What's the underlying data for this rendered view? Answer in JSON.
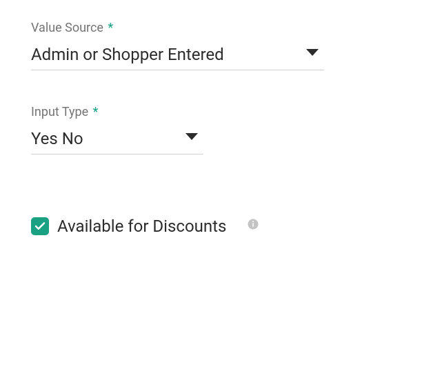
{
  "fields": {
    "valueSource": {
      "label": "Value Source",
      "required": true,
      "value": "Admin or Shopper Entered"
    },
    "inputType": {
      "label": "Input Type",
      "required": true,
      "value": "Yes No"
    },
    "availableForDiscounts": {
      "label": "Available for Discounts",
      "checked": true
    }
  },
  "asterisk": "*"
}
